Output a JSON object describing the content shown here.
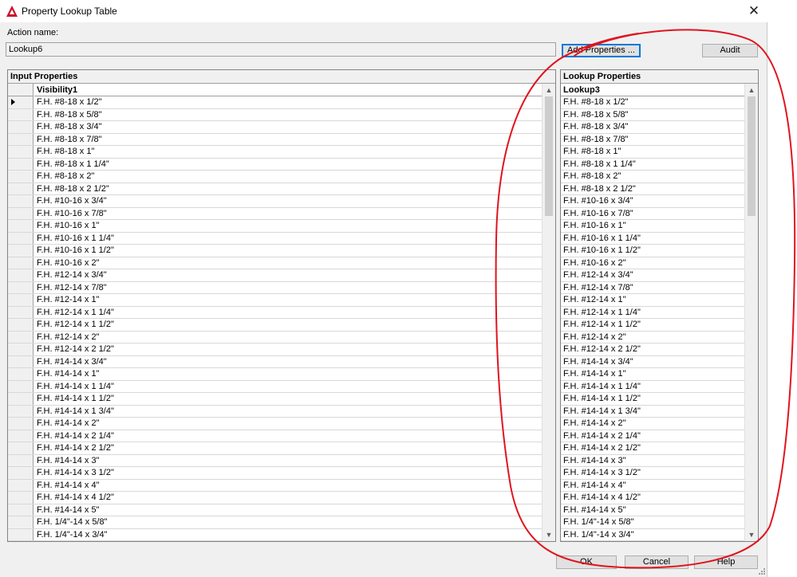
{
  "window": {
    "title": "Property Lookup Table",
    "app_icon": "autocad-icon",
    "close_icon": "close-icon"
  },
  "action": {
    "label": "Action name:",
    "value": "Lookup6"
  },
  "buttons": {
    "add_properties": "Add Properties ...",
    "audit": "Audit",
    "ok": "OK",
    "cancel": "Cancel",
    "help": "Help"
  },
  "input_panel": {
    "title": "Input Properties",
    "column": "Visibility1",
    "rows": [
      "F.H. #8-18 x 1/2\"",
      "F.H. #8-18 x 5/8\"",
      "F.H. #8-18 x 3/4\"",
      "F.H. #8-18 x 7/8\"",
      "F.H. #8-18 x 1\"",
      "F.H. #8-18 x 1 1/4\"",
      "F.H. #8-18 x 2\"",
      "F.H. #8-18 x 2 1/2\"",
      "F.H. #10-16 x 3/4\"",
      "F.H. #10-16 x 7/8\"",
      "F.H. #10-16 x 1\"",
      "F.H. #10-16 x 1 1/4\"",
      "F.H. #10-16 x 1 1/2\"",
      "F.H. #10-16 x 2\"",
      "F.H. #12-14 x 3/4\"",
      "F.H. #12-14 x 7/8\"",
      "F.H. #12-14 x 1\"",
      "F.H. #12-14 x 1 1/4\"",
      "F.H. #12-14 x 1 1/2\"",
      "F.H. #12-14 x 2\"",
      "F.H. #12-14 x 2 1/2\"",
      "F.H. #14-14 x 3/4\"",
      "F.H. #14-14 x 1\"",
      "F.H. #14-14 x 1 1/4\"",
      "F.H. #14-14 x 1 1/2\"",
      "F.H. #14-14 x 1 3/4\"",
      "F.H. #14-14 x 2\"",
      "F.H. #14-14 x 2 1/4\"",
      "F.H. #14-14 x 2 1/2\"",
      "F.H. #14-14 x 3\"",
      "F.H. #14-14 x 3 1/2\"",
      "F.H. #14-14 x 4\"",
      "F.H. #14-14 x 4 1/2\"",
      "F.H. #14-14 x 5\"",
      "F.H. 1/4\"-14 x 5/8\"",
      "F.H. 1/4\"-14 x 3/4\""
    ]
  },
  "lookup_panel": {
    "title": "Lookup Properties",
    "column": "Lookup3",
    "rows": [
      "F.H. #8-18 x 1/2\"",
      "F.H. #8-18 x 5/8\"",
      "F.H. #8-18 x 3/4\"",
      "F.H. #8-18 x 7/8\"",
      "F.H. #8-18 x 1\"",
      "F.H. #8-18 x 1 1/4\"",
      "F.H. #8-18 x 2\"",
      "F.H. #8-18 x 2 1/2\"",
      "F.H. #10-16 x 3/4\"",
      "F.H. #10-16 x 7/8\"",
      "F.H. #10-16 x 1\"",
      "F.H. #10-16 x 1 1/4\"",
      "F.H. #10-16 x 1 1/2\"",
      "F.H. #10-16 x 2\"",
      "F.H. #12-14 x 3/4\"",
      "F.H. #12-14 x 7/8\"",
      "F.H. #12-14 x 1\"",
      "F.H. #12-14 x 1 1/4\"",
      "F.H. #12-14 x 1 1/2\"",
      "F.H. #12-14 x 2\"",
      "F.H. #12-14 x 2 1/2\"",
      "F.H. #14-14 x 3/4\"",
      "F.H. #14-14 x 1\"",
      "F.H. #14-14 x 1 1/4\"",
      "F.H. #14-14 x 1 1/2\"",
      "F.H. #14-14 x 1 3/4\"",
      "F.H. #14-14 x 2\"",
      "F.H. #14-14 x 2 1/4\"",
      "F.H. #14-14 x 2 1/2\"",
      "F.H. #14-14 x 3\"",
      "F.H. #14-14 x 3 1/2\"",
      "F.H. #14-14 x 4\"",
      "F.H. #14-14 x 4 1/2\"",
      "F.H. #14-14 x 5\"",
      "F.H. 1/4\"-14 x 5/8\"",
      "F.H. 1/4\"-14 x 3/4\""
    ]
  },
  "colors": {
    "annotation": "#e0141e",
    "dialog_bg": "#f0f0f0",
    "default_button_border": "#0078d7"
  }
}
